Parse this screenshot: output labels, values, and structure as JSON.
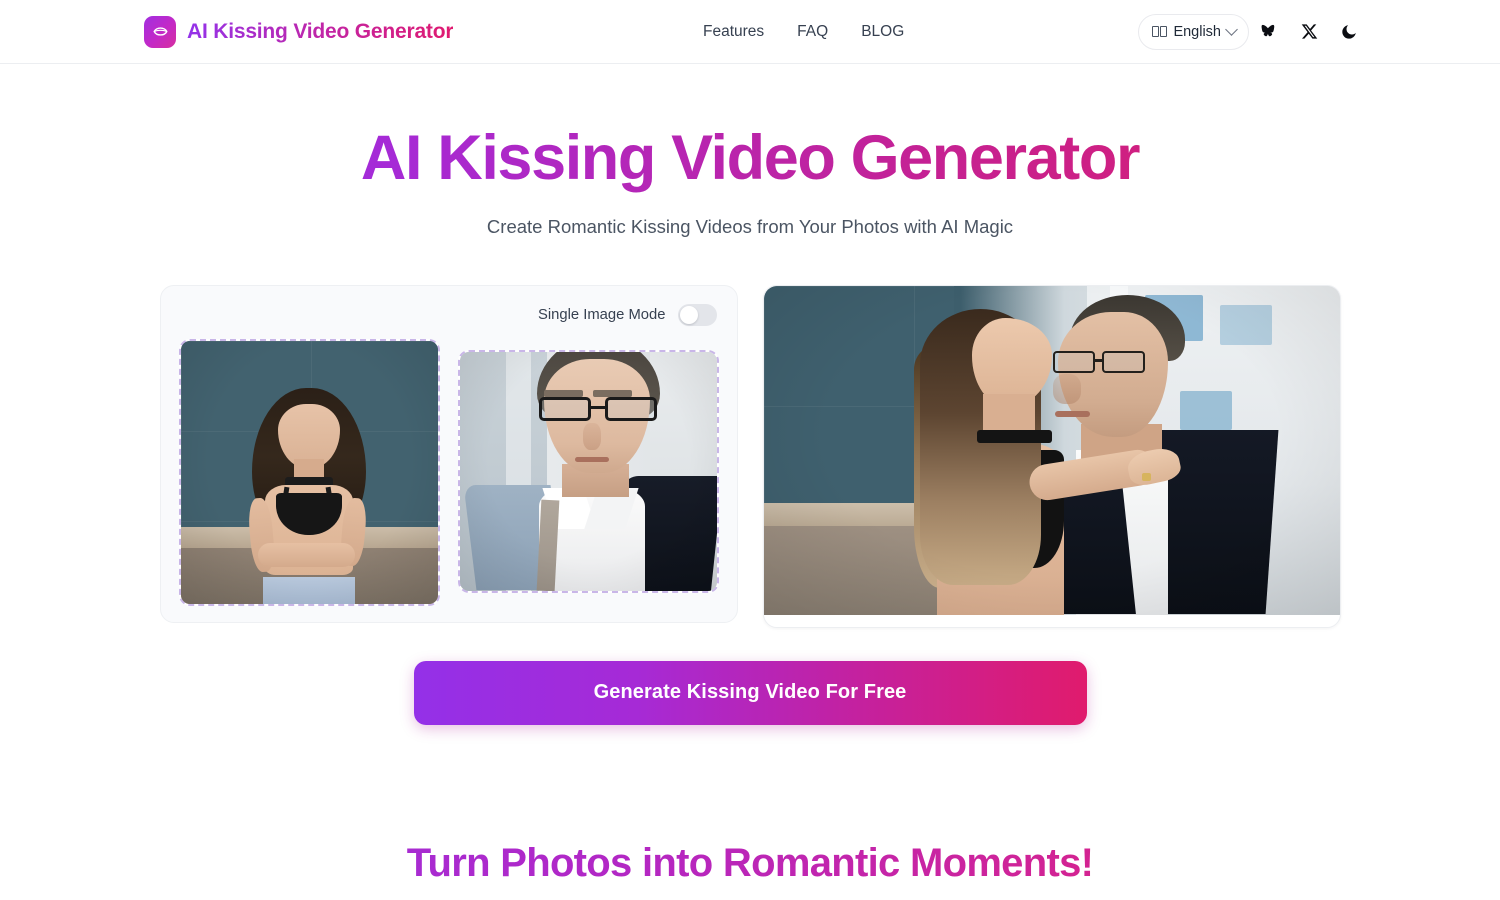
{
  "header": {
    "brand_name": "AI Kissing Video Generator",
    "logo_icon": "kiss-lips-icon",
    "nav": [
      {
        "label": "Features",
        "name": "nav-features"
      },
      {
        "label": "FAQ",
        "name": "nav-faq"
      },
      {
        "label": "BLOG",
        "name": "nav-blog"
      }
    ],
    "language": {
      "label": "English",
      "flag_glyph": "□□",
      "chevron_icon": "chevron-down-icon"
    },
    "social": [
      {
        "name": "bluesky-icon",
        "label": "Bluesky"
      },
      {
        "name": "x-twitter-icon",
        "label": "X"
      }
    ],
    "theme_toggle": {
      "name": "dark-mode-moon-icon",
      "label": "Dark mode"
    }
  },
  "hero": {
    "title": "AI Kissing Video Generator",
    "subtitle": "Create Romantic Kissing Videos from Your Photos with AI Magic"
  },
  "workspace": {
    "single_image_mode": {
      "label": "Single Image Mode",
      "enabled": false
    },
    "slots": [
      {
        "name": "upload-slot-person-1",
        "alt": "Uploaded photo of a woman standing against a teal wall"
      },
      {
        "name": "upload-slot-person-2",
        "alt": "Uploaded photo of a man with glasses in a dark suit"
      }
    ],
    "preview": {
      "name": "result-preview",
      "alt": "Generated preview of a couple about to kiss"
    }
  },
  "cta": {
    "label": "Generate Kissing Video For Free"
  },
  "section": {
    "title": "Turn Photos into Romantic Moments!"
  },
  "colors": {
    "gradient_start": "#9333ea",
    "gradient_end": "#e01b6d",
    "nav_text": "#374151",
    "subtitle_text": "#4b5563",
    "card_bg": "#f9fafc",
    "slot_border": "#c9b6e8",
    "toggle_track": "#e3e5ea"
  }
}
